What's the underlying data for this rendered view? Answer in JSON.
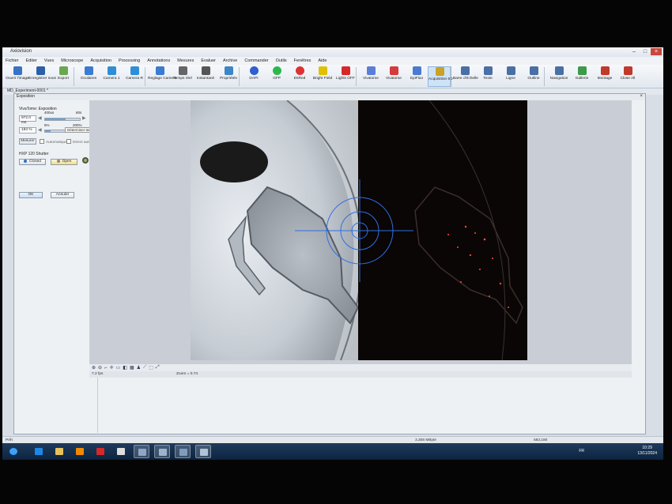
{
  "window": {
    "title": "Axiovision"
  },
  "menu": [
    "Fichier",
    "Editer",
    "Vues",
    "Microscope",
    "Acquisition",
    "Processing",
    "Annotations",
    "Mesures",
    "Evaluer",
    "Archive",
    "Commander",
    "Outils",
    "Fenêtres",
    "Aide"
  ],
  "toolbar": [
    {
      "label": "Ouvrir l'image",
      "color": "#3a72c4"
    },
    {
      "label": "Enregistrer sous",
      "color": "#2b5fa8"
    },
    {
      "label": "Export",
      "color": "#6aa84f"
    },
    {
      "label": "Oculaires",
      "color": "#3b7bd1"
    },
    {
      "label": "Camera 1",
      "color": "#2f8fd6"
    },
    {
      "label": "Camera R",
      "color": "#2f8fd6"
    },
    {
      "label": "Reglage Camera",
      "color": "#3b7bd1"
    },
    {
      "label": "Temps réel",
      "color": "#666666"
    },
    {
      "label": "Instantané",
      "color": "#555555"
    },
    {
      "label": "Propriétés",
      "color": "#3d85c6"
    },
    {
      "label": "DAPI",
      "color": "#2f5fd0"
    },
    {
      "label": "GFP",
      "color": "#2db84d"
    },
    {
      "label": "DsRed",
      "color": "#e03131"
    },
    {
      "label": "Bright Field",
      "color": "#e0c000"
    },
    {
      "label": "Lights OFF",
      "color": "#d62828"
    },
    {
      "label": "Vivatome",
      "color": "#5b7fd6"
    },
    {
      "label": "Vivatome",
      "color": "#d63b3b"
    },
    {
      "label": "EpiFluo",
      "color": "#4a7bd0"
    },
    {
      "label": "Acquisition 6D",
      "color": "#c9a227"
    },
    {
      "label": "Barre d'échelle",
      "color": "#4a6fa5"
    },
    {
      "label": "Texte",
      "color": "#4a6fa5"
    },
    {
      "label": "Ligne",
      "color": "#4a6fa5"
    },
    {
      "label": "Outline",
      "color": "#4a6fa5"
    },
    {
      "label": "Navigation",
      "color": "#4a6fa5"
    },
    {
      "label": "Gallerie",
      "color": "#3c9a4a"
    },
    {
      "label": "Montage",
      "color": "#c0392b"
    },
    {
      "label": "Close All",
      "color": "#c0392b"
    }
  ],
  "document": {
    "tab": "MD_Experiment-0001 *",
    "panel_title": "Exposition"
  },
  "panel": {
    "section": "VivaTome: Exposition",
    "exposure_value": "972.0 ms",
    "exposure_min": "400us",
    "exposure_max": "60s",
    "exposure_fraction": 0.6,
    "gain_value": "183 %",
    "gain_min": "5%",
    "gain_max": "200%",
    "gain_fraction": 0.15,
    "tooltip": "Déterminer temps d'exposition",
    "measure_button": "Mesurer",
    "auto_check": "Automatique",
    "direct_check": "Direct auto",
    "shutter_label": "HXP 120 Shutter",
    "closed_button": "Closed",
    "open_button": "Open",
    "ok_button": "OK",
    "cancel_button": "Annuler"
  },
  "viewer": {
    "fps": "7.2 fps",
    "zoom": "Zoom = 0.74"
  },
  "statusbar": {
    "left": "Prêt",
    "mid": "3,306 MByte",
    "right": "583,180"
  },
  "taskbar": {
    "lang": "FR",
    "time": "10:29",
    "date": "13/11/2024",
    "apps": [
      {
        "name": "start",
        "color": "#3ca0ff"
      },
      {
        "name": "ie",
        "color": "#1e88e5"
      },
      {
        "name": "explorer",
        "color": "#e8c15a"
      },
      {
        "name": "vlc",
        "color": "#f08a00"
      },
      {
        "name": "pdf",
        "color": "#d62828"
      },
      {
        "name": "file",
        "color": "#dddddd"
      },
      {
        "name": "axiovision",
        "color": "#8fa6c4"
      },
      {
        "name": "app2",
        "color": "#9fb4cc"
      },
      {
        "name": "app3",
        "color": "#7f9bbd"
      },
      {
        "name": "app4",
        "color": "#b0c4d8"
      }
    ]
  }
}
